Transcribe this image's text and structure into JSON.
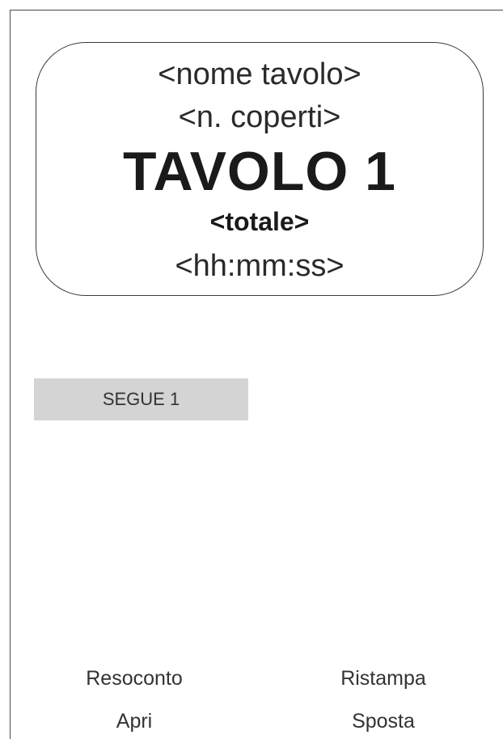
{
  "table_card": {
    "name_placeholder": "<nome tavolo>",
    "covers_placeholder": "<n. coperti>",
    "title": "TAVOLO 1",
    "total_placeholder": "<totale>",
    "time_placeholder": "<hh:mm:ss>"
  },
  "segue": {
    "label": "SEGUE 1"
  },
  "actions": {
    "resoconto": "Resoconto",
    "ristampa": "Ristampa",
    "apri": "Apri",
    "sposta": "Sposta"
  },
  "colors": {
    "background": "#ffffff",
    "button_bg": "#d4d4d4",
    "text": "#1e1e1e",
    "border": "#3a3a3a"
  }
}
